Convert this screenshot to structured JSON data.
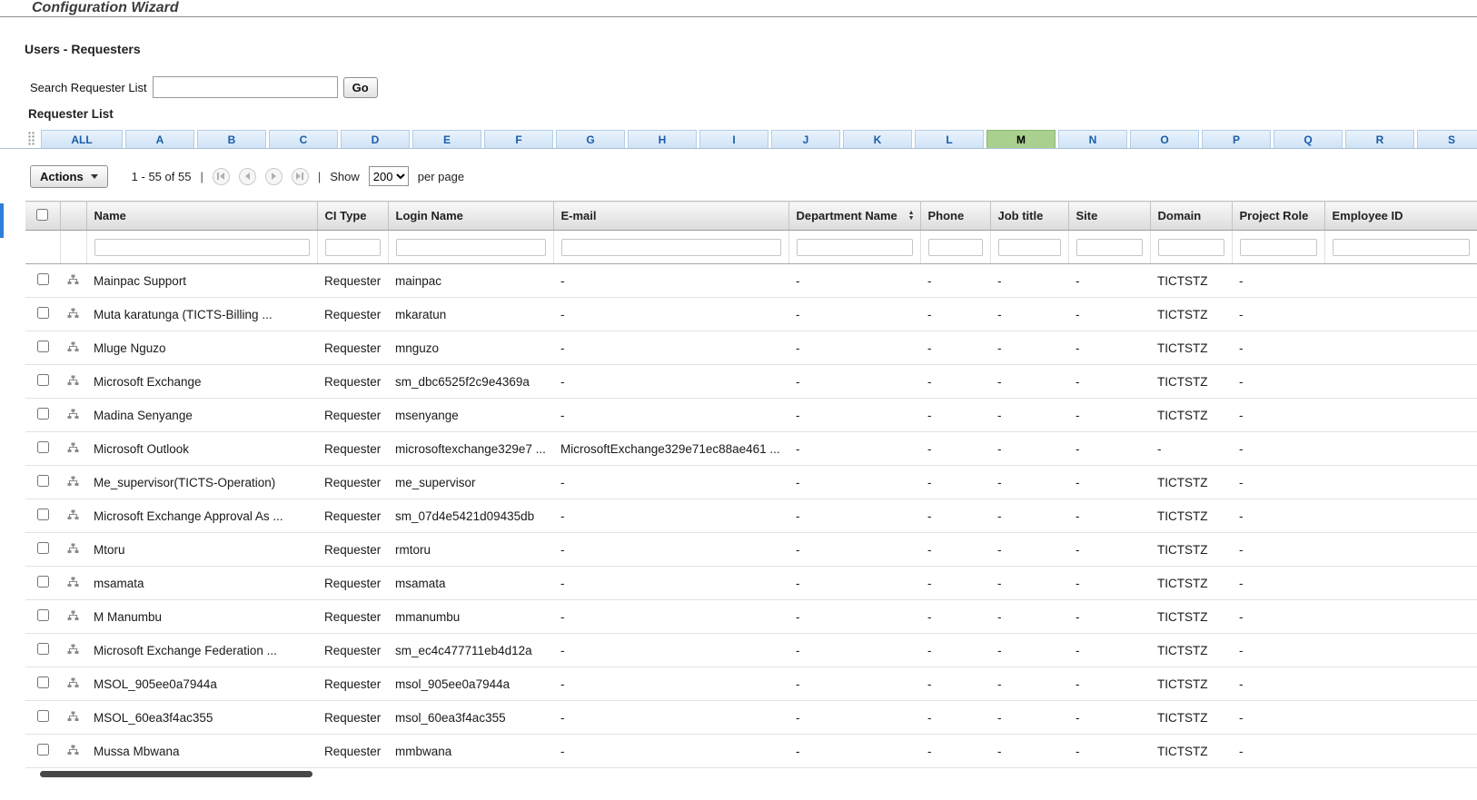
{
  "header": {
    "app_title": "Configuration Wizard"
  },
  "page": {
    "section_title": "Users - Requesters"
  },
  "search": {
    "label": "Search Requester List",
    "value": "",
    "go_label": "Go"
  },
  "list": {
    "title": "Requester List"
  },
  "alpha_tabs": {
    "items": [
      "ALL",
      "A",
      "B",
      "C",
      "D",
      "E",
      "F",
      "G",
      "H",
      "I",
      "J",
      "K",
      "L",
      "M",
      "N",
      "O",
      "P",
      "Q",
      "R",
      "S"
    ],
    "active": "M"
  },
  "toolbar": {
    "actions_label": "Actions",
    "range_text": "1 - 55 of 55",
    "separator": "|",
    "show_label": "Show",
    "page_size": "200",
    "per_page_label": "per page"
  },
  "colors": {
    "tab_text": "#1a5da8",
    "tab_bg": "#d9e9f8",
    "tab_active_bg": "#a9d08e",
    "left_accent": "#2f7ed8"
  },
  "table": {
    "columns": [
      {
        "key": "name",
        "label": "Name"
      },
      {
        "key": "ci_type",
        "label": "CI Type"
      },
      {
        "key": "login",
        "label": "Login Name"
      },
      {
        "key": "email",
        "label": "E-mail"
      },
      {
        "key": "department",
        "label": "Department Name",
        "sortable": true
      },
      {
        "key": "phone",
        "label": "Phone"
      },
      {
        "key": "job_title",
        "label": "Job title"
      },
      {
        "key": "site",
        "label": "Site"
      },
      {
        "key": "domain",
        "label": "Domain"
      },
      {
        "key": "project_role",
        "label": "Project Role"
      },
      {
        "key": "employee_id",
        "label": "Employee ID"
      }
    ],
    "rows": [
      {
        "name": "Mainpac Support",
        "ci_type": "Requester",
        "login": "mainpac",
        "email": "-",
        "department": "-",
        "phone": "-",
        "job_title": "-",
        "site": "-",
        "domain": "TICTSTZ",
        "project_role": "-",
        "employee_id": ""
      },
      {
        "name": "Muta karatunga (TICTS-Billing ...",
        "ci_type": "Requester",
        "login": "mkaratun",
        "email": "-",
        "department": "-",
        "phone": "-",
        "job_title": "-",
        "site": "-",
        "domain": "TICTSTZ",
        "project_role": "-",
        "employee_id": ""
      },
      {
        "name": "Mluge Nguzo",
        "ci_type": "Requester",
        "login": "mnguzo",
        "email": "-",
        "department": "-",
        "phone": "-",
        "job_title": "-",
        "site": "-",
        "domain": "TICTSTZ",
        "project_role": "-",
        "employee_id": ""
      },
      {
        "name": "Microsoft Exchange",
        "ci_type": "Requester",
        "login": "sm_dbc6525f2c9e4369a",
        "email": "-",
        "department": "-",
        "phone": "-",
        "job_title": "-",
        "site": "-",
        "domain": "TICTSTZ",
        "project_role": "-",
        "employee_id": ""
      },
      {
        "name": "Madina Senyange",
        "ci_type": "Requester",
        "login": "msenyange",
        "email": "-",
        "department": "-",
        "phone": "-",
        "job_title": "-",
        "site": "-",
        "domain": "TICTSTZ",
        "project_role": "-",
        "employee_id": ""
      },
      {
        "name": "Microsoft Outlook",
        "ci_type": "Requester",
        "login": "microsoftexchange329e7 ...",
        "email": "MicrosoftExchange329e71ec88ae461 ...",
        "department": "-",
        "phone": "-",
        "job_title": "-",
        "site": "-",
        "domain": "-",
        "project_role": "-",
        "employee_id": ""
      },
      {
        "name": "Me_supervisor(TICTS-Operation)",
        "ci_type": "Requester",
        "login": "me_supervisor",
        "email": "-",
        "department": "-",
        "phone": "-",
        "job_title": "-",
        "site": "-",
        "domain": "TICTSTZ",
        "project_role": "-",
        "employee_id": ""
      },
      {
        "name": "Microsoft Exchange Approval As ...",
        "ci_type": "Requester",
        "login": "sm_07d4e5421d09435db",
        "email": "-",
        "department": "-",
        "phone": "-",
        "job_title": "-",
        "site": "-",
        "domain": "TICTSTZ",
        "project_role": "-",
        "employee_id": ""
      },
      {
        "name": "Mtoru",
        "ci_type": "Requester",
        "login": "rmtoru",
        "email": "-",
        "department": "-",
        "phone": "-",
        "job_title": "-",
        "site": "-",
        "domain": "TICTSTZ",
        "project_role": "-",
        "employee_id": ""
      },
      {
        "name": "msamata",
        "ci_type": "Requester",
        "login": "msamata",
        "email": "-",
        "department": "-",
        "phone": "-",
        "job_title": "-",
        "site": "-",
        "domain": "TICTSTZ",
        "project_role": "-",
        "employee_id": ""
      },
      {
        "name": "M Manumbu",
        "ci_type": "Requester",
        "login": "mmanumbu",
        "email": "-",
        "department": "-",
        "phone": "-",
        "job_title": "-",
        "site": "-",
        "domain": "TICTSTZ",
        "project_role": "-",
        "employee_id": ""
      },
      {
        "name": "Microsoft Exchange Federation ...",
        "ci_type": "Requester",
        "login": "sm_ec4c477711eb4d12a",
        "email": "-",
        "department": "-",
        "phone": "-",
        "job_title": "-",
        "site": "-",
        "domain": "TICTSTZ",
        "project_role": "-",
        "employee_id": ""
      },
      {
        "name": "MSOL_905ee0a7944a",
        "ci_type": "Requester",
        "login": "msol_905ee0a7944a",
        "email": "-",
        "department": "-",
        "phone": "-",
        "job_title": "-",
        "site": "-",
        "domain": "TICTSTZ",
        "project_role": "-",
        "employee_id": ""
      },
      {
        "name": "MSOL_60ea3f4ac355",
        "ci_type": "Requester",
        "login": "msol_60ea3f4ac355",
        "email": "-",
        "department": "-",
        "phone": "-",
        "job_title": "-",
        "site": "-",
        "domain": "TICTSTZ",
        "project_role": "-",
        "employee_id": ""
      },
      {
        "name": "Mussa Mbwana",
        "ci_type": "Requester",
        "login": "mmbwana",
        "email": "-",
        "department": "-",
        "phone": "-",
        "job_title": "-",
        "site": "-",
        "domain": "TICTSTZ",
        "project_role": "-",
        "employee_id": ""
      }
    ]
  }
}
